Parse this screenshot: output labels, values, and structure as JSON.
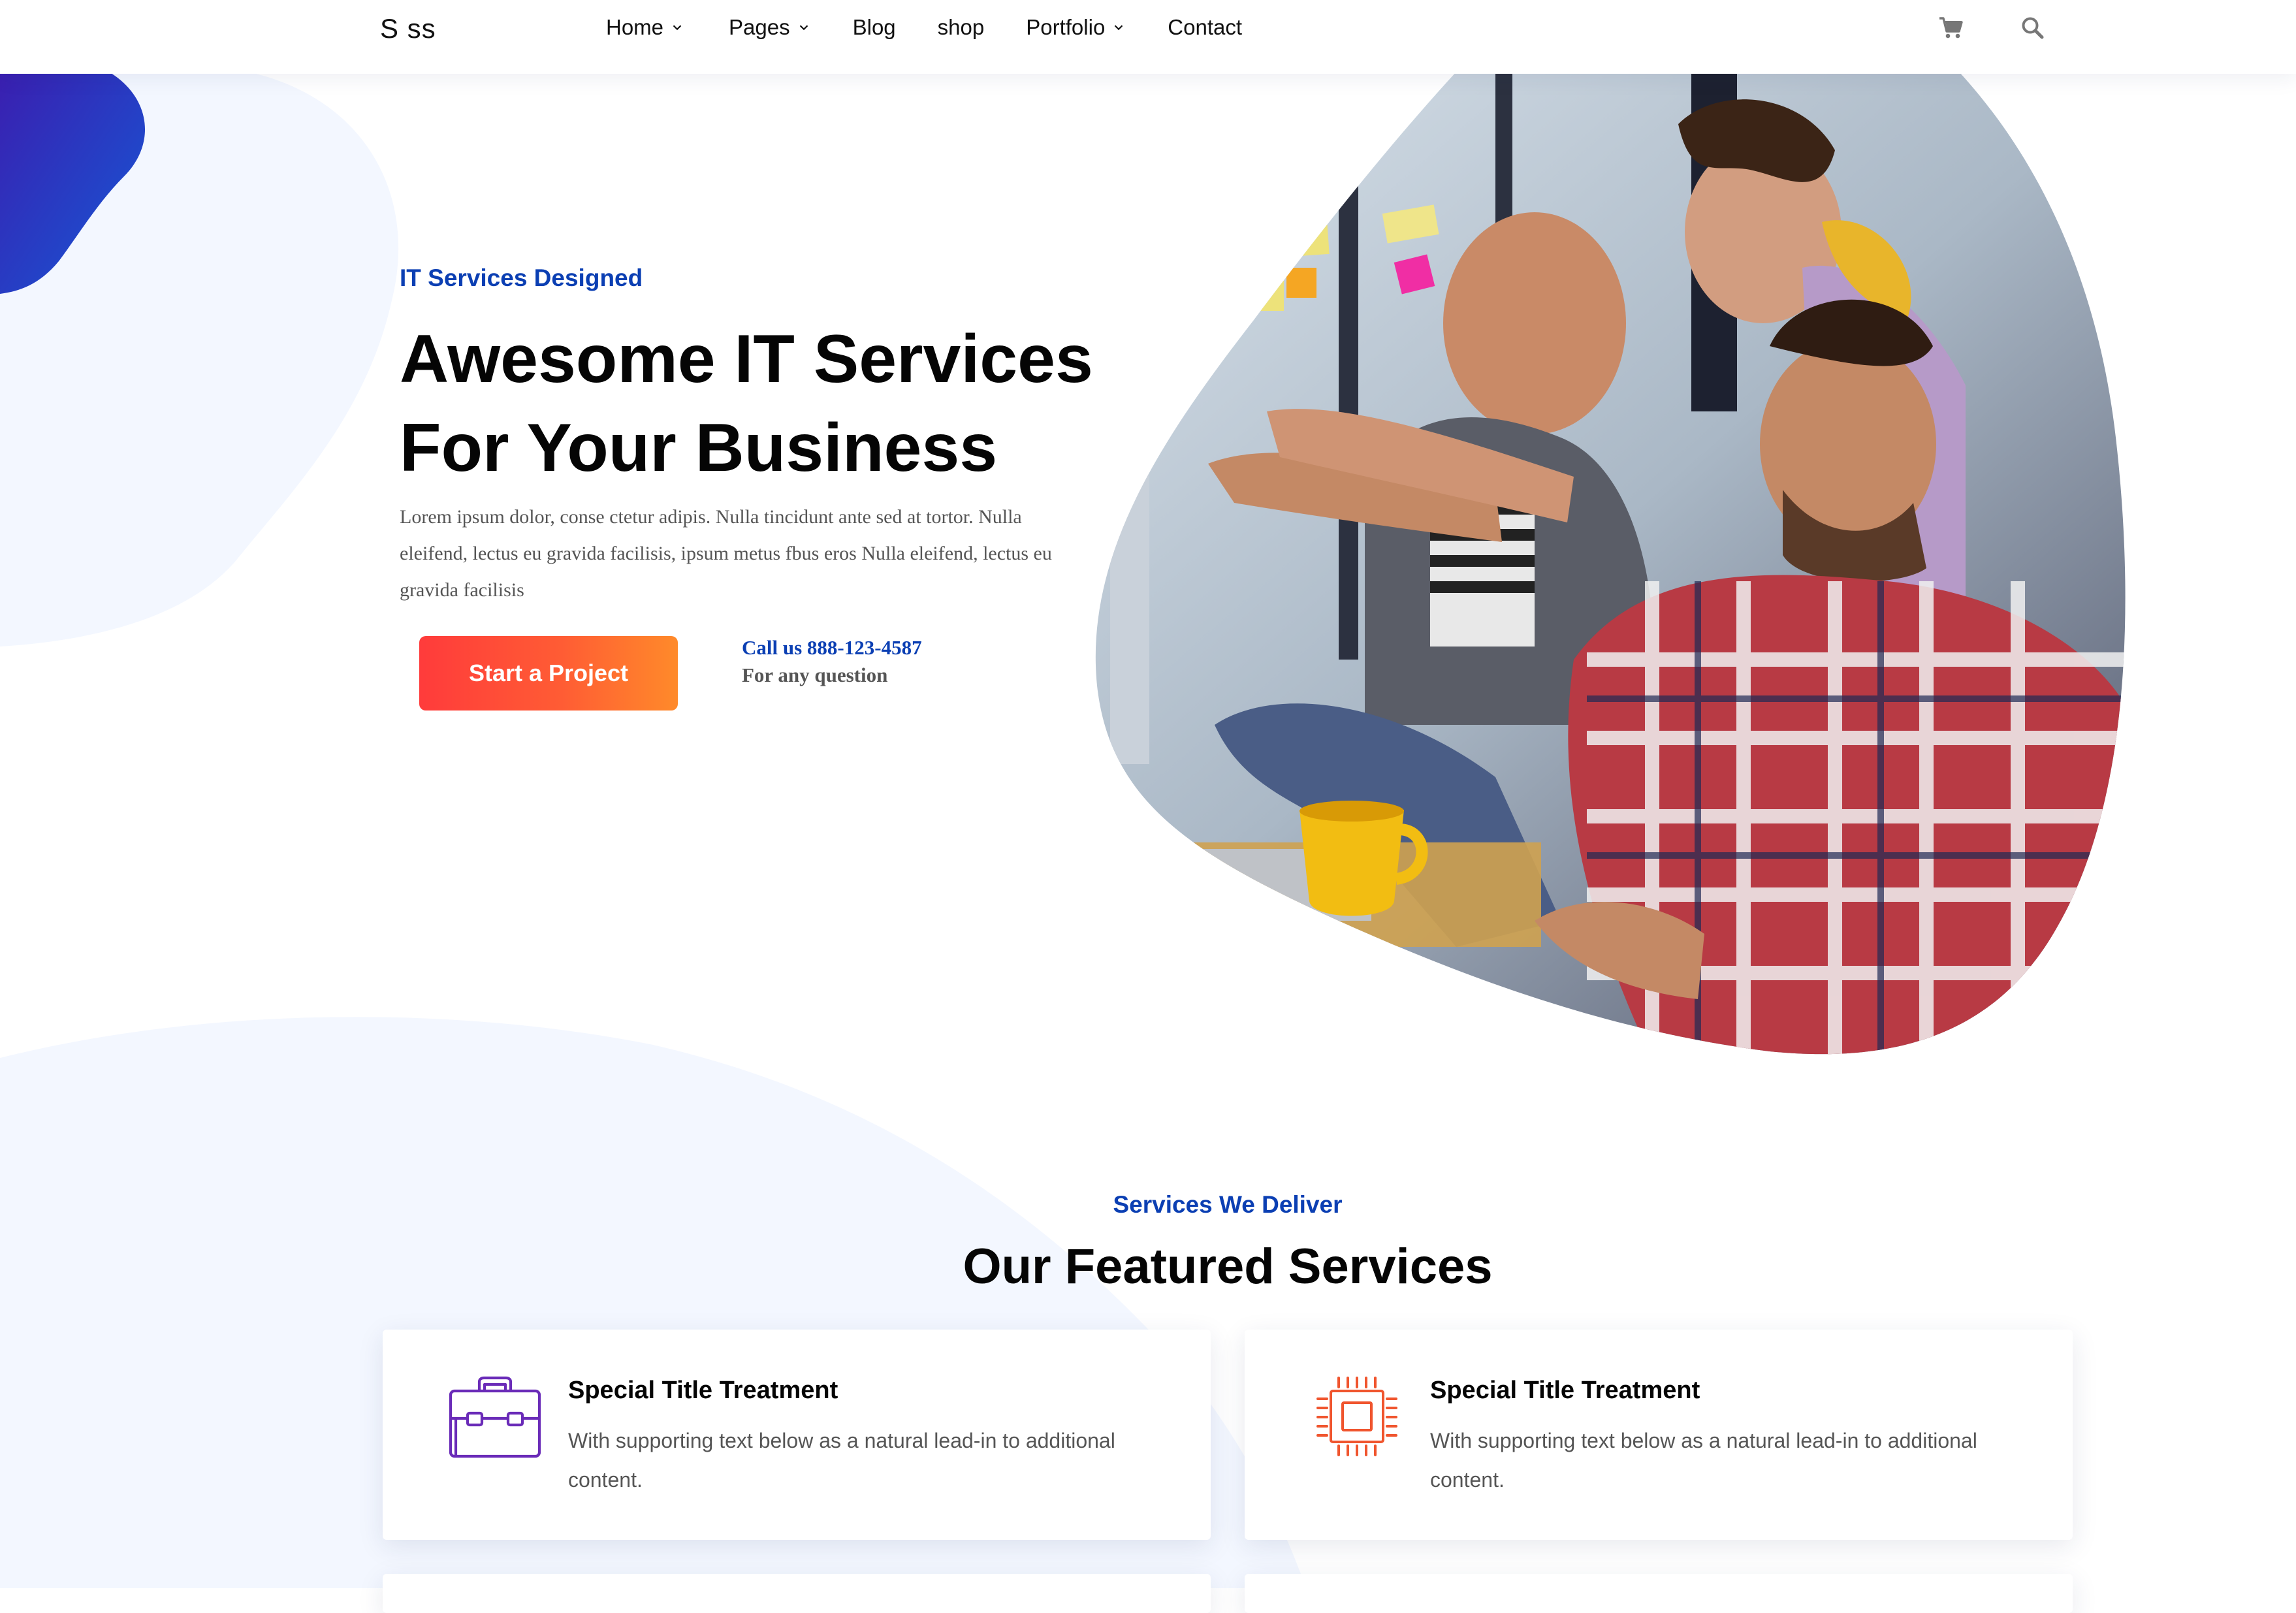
{
  "brand": {
    "logo_text": "S ss"
  },
  "nav": {
    "items": [
      {
        "label": "Home",
        "has_dropdown": true
      },
      {
        "label": "Pages",
        "has_dropdown": true
      },
      {
        "label": "Blog",
        "has_dropdown": false
      },
      {
        "label": "shop",
        "has_dropdown": false
      },
      {
        "label": "Portfolio",
        "has_dropdown": true
      },
      {
        "label": "Contact",
        "has_dropdown": false
      }
    ],
    "icons": [
      "cart-icon",
      "search-icon"
    ]
  },
  "hero": {
    "eyebrow": "IT Services Designed",
    "title_line1": "Awesome IT Services",
    "title_line2": "For Your Business",
    "description": "Lorem ipsum dolor, conse ctetur adipis. Nulla tincidunt ante sed at tortor. Nulla eleifend, lectus eu gravida facilisis, ipsum metus fbus eros Nulla eleifend, lectus eu gravida facilisis",
    "cta_label": "Start a Project",
    "call_text": "Call us 888-123-4587",
    "call_subtext": "For any question",
    "image_icon": "photo-team-collaboration"
  },
  "services": {
    "eyebrow": "Services We Deliver",
    "title": "Our Featured Services",
    "cards": [
      {
        "icon": "briefcase-icon",
        "title": "Special Title Treatment",
        "text": "With supporting text below as a natural lead-in to additional content."
      },
      {
        "icon": "chip-icon",
        "title": "Special Title Treatment",
        "text": "With supporting text below as a natural lead-in to additional content."
      }
    ]
  },
  "colors": {
    "accent_blue": "#0b3fb3",
    "cta_gradient_start": "#ff3b3b",
    "cta_gradient_end": "#ff8a2a",
    "briefcase_purple": "#6a2bb8",
    "chip_orange": "#f0552e"
  }
}
